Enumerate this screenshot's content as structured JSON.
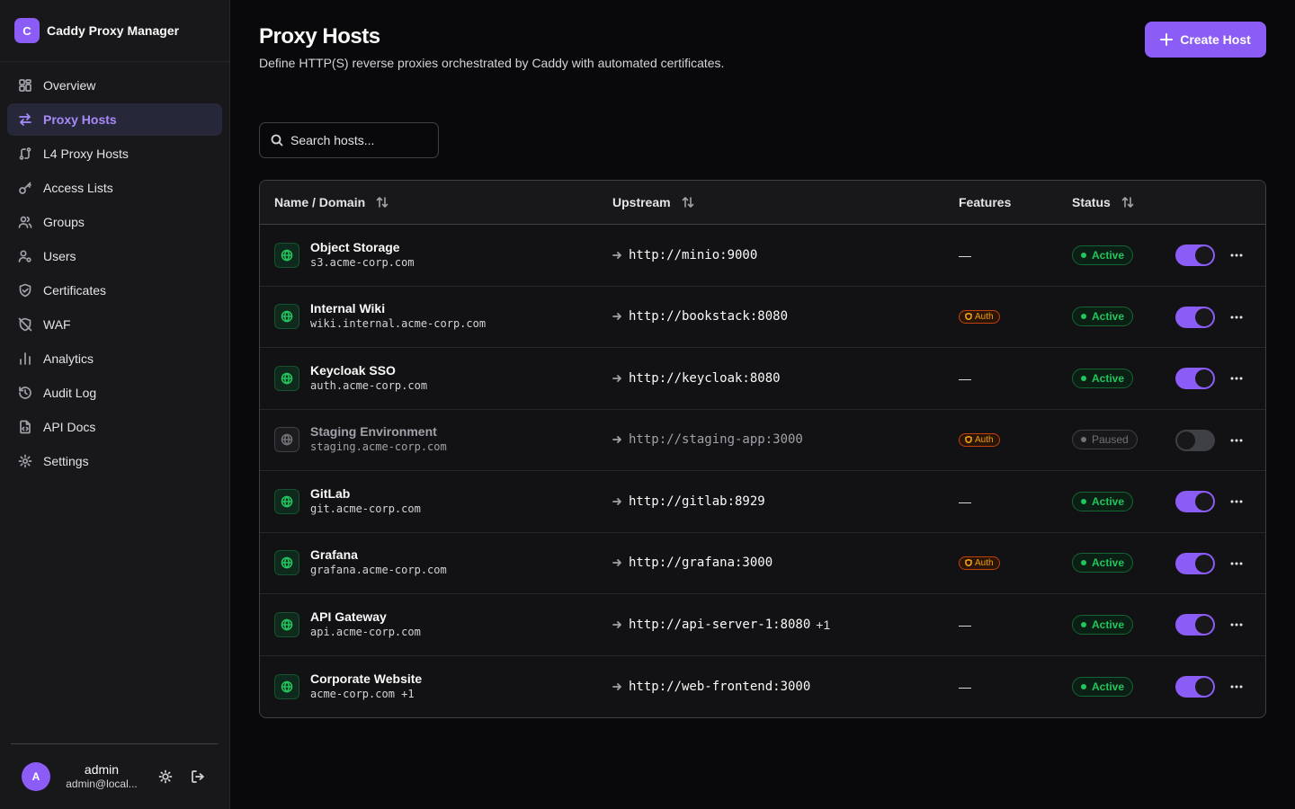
{
  "app": {
    "title": "Caddy Proxy Manager",
    "logo_letter": "C",
    "accent": "#8b5cf6"
  },
  "sidebar": {
    "items": [
      {
        "label": "Overview",
        "icon": "grid-icon"
      },
      {
        "label": "Proxy Hosts",
        "icon": "arrows-left-right-icon",
        "active": true
      },
      {
        "label": "L4 Proxy Hosts",
        "icon": "route-icon"
      },
      {
        "label": "Access Lists",
        "icon": "key-icon"
      },
      {
        "label": "Groups",
        "icon": "users-group-icon"
      },
      {
        "label": "Users",
        "icon": "user-cog-icon"
      },
      {
        "label": "Certificates",
        "icon": "shield-check-icon"
      },
      {
        "label": "WAF",
        "icon": "shield-off-icon"
      },
      {
        "label": "Analytics",
        "icon": "bar-chart-icon"
      },
      {
        "label": "Audit Log",
        "icon": "history-icon"
      },
      {
        "label": "API Docs",
        "icon": "file-code-icon"
      },
      {
        "label": "Settings",
        "icon": "gear-icon"
      }
    ]
  },
  "user": {
    "avatar_letter": "A",
    "name": "admin",
    "email": "admin@local..."
  },
  "page": {
    "title": "Proxy Hosts",
    "subtitle": "Define HTTP(S) reverse proxies orchestrated by Caddy with automated certificates.",
    "create_label": "Create Host"
  },
  "search": {
    "placeholder": "Search hosts..."
  },
  "table": {
    "columns": {
      "name": "Name / Domain",
      "upstream": "Upstream",
      "features": "Features",
      "status": "Status"
    },
    "rows": [
      {
        "name": "Object Storage",
        "domain": "s3.acme-corp.com",
        "upstream": "http://minio:9000",
        "upstream_extra": "",
        "feature": "—",
        "status": "Active",
        "enabled": true
      },
      {
        "name": "Internal Wiki",
        "domain": "wiki.internal.acme-corp.com",
        "upstream": "http://bookstack:8080",
        "upstream_extra": "",
        "feature": "Auth",
        "status": "Active",
        "enabled": true
      },
      {
        "name": "Keycloak SSO",
        "domain": "auth.acme-corp.com",
        "upstream": "http://keycloak:8080",
        "upstream_extra": "",
        "feature": "—",
        "status": "Active",
        "enabled": true
      },
      {
        "name": "Staging Environment",
        "domain": "staging.acme-corp.com",
        "upstream": "http://staging-app:3000",
        "upstream_extra": "",
        "feature": "Auth",
        "status": "Paused",
        "enabled": false
      },
      {
        "name": "GitLab",
        "domain": "git.acme-corp.com",
        "upstream": "http://gitlab:8929",
        "upstream_extra": "",
        "feature": "—",
        "status": "Active",
        "enabled": true
      },
      {
        "name": "Grafana",
        "domain": "grafana.acme-corp.com",
        "upstream": "http://grafana:3000",
        "upstream_extra": "",
        "feature": "Auth",
        "status": "Active",
        "enabled": true
      },
      {
        "name": "API Gateway",
        "domain": "api.acme-corp.com",
        "upstream": "http://api-server-1:8080",
        "upstream_extra": "+1",
        "feature": "—",
        "status": "Active",
        "enabled": true
      },
      {
        "name": "Corporate Website",
        "domain": "acme-corp.com +1",
        "upstream": "http://web-frontend:3000",
        "upstream_extra": "",
        "feature": "—",
        "status": "Active",
        "enabled": true
      }
    ]
  }
}
